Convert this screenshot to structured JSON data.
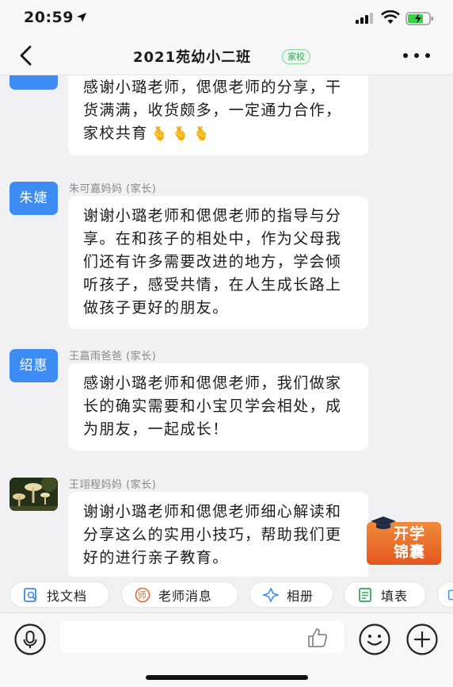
{
  "status_bar": {
    "time": "20:59"
  },
  "nav": {
    "title": "2021苑幼小二班",
    "tag": "家校"
  },
  "messages": [
    {
      "avatar": "",
      "sender": "",
      "text": "感谢小璐老师，偲偲老师的分享，干货满满，收货颇多，一定通力合作，家校共育",
      "emojis": [
        "🫰",
        "🫰",
        "🫰"
      ]
    },
    {
      "avatar": "朱婕",
      "sender": "朱可嘉妈妈 (家长)",
      "text": "谢谢小璐老师和偲偲老师的指导与分享。在和孩子的相处中，作为父母我们还有许多需要改进的地方，学会倾听孩子，感受共情，在人生成长路上做孩子更好的朋友。"
    },
    {
      "avatar": "绍惠",
      "sender": "王嘉雨爸爸 (家长)",
      "text": "感谢小璐老师和偲偲老师，我们做家长的确实需要和小宝贝学会相处，成为朋友，一起成长！"
    },
    {
      "avatar": "",
      "sender": "王翊程妈妈 (家长)",
      "text": "谢谢小璐老师和偲偲老师细心解读和分享这么的实用小技巧，帮助我们更好的进行亲子教育。"
    }
  ],
  "badge": {
    "line1": "开学",
    "line2": "锦囊"
  },
  "quick_actions": [
    {
      "label": "找文档",
      "icon": "doc-search-icon"
    },
    {
      "label": "老师消息",
      "icon": "teacher-icon"
    },
    {
      "label": "相册",
      "icon": "album-icon"
    },
    {
      "label": "填表",
      "icon": "form-icon"
    }
  ],
  "input": {
    "placeholder": ""
  },
  "colors": {
    "avatar_blue": "#3d8cf4",
    "tag_green": "#35a356",
    "accent_blue": "#3d8cf4",
    "accent_orange": "#e8662a"
  }
}
